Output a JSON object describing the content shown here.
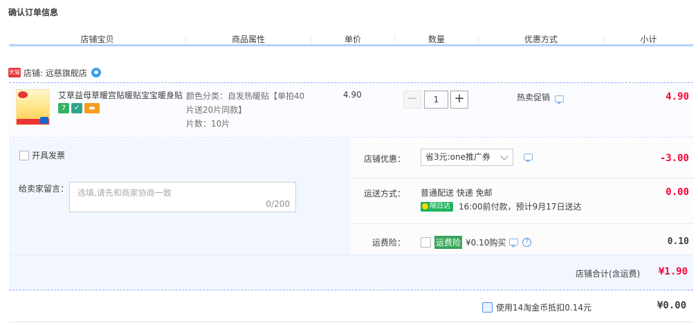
{
  "page": {
    "title": "确认订单信息"
  },
  "columns": [
    "店铺宝贝",
    "商品属性",
    "单价",
    "数量",
    "优惠方式",
    "小计"
  ],
  "shop": {
    "platform_badge": "天猫",
    "label": "店铺: 远慈旗舰店"
  },
  "item": {
    "title": "艾草益母草暖宫贴暖贴宝宝暖身贴",
    "badges": [
      "7",
      "✓",
      "▬"
    ],
    "attr_line1": "颜色分类：自发热暖贴【单拍40",
    "attr_line2": "片送20片同款】",
    "attr_line3": "片数：10片",
    "unit_price": "4.90",
    "quantity": "1",
    "qty_minus": "−",
    "qty_plus": "+",
    "promo": "热卖促销",
    "subtotal": "4.90"
  },
  "invoice": {
    "label": "开具发票"
  },
  "message": {
    "label": "给卖家留言：",
    "placeholder": "选填,请先和商家协商一致",
    "count": "0/200"
  },
  "coupon": {
    "label": "店铺优惠：",
    "selected": "省3元:one推广券",
    "amount": "-3.00"
  },
  "shipping": {
    "label": "运送方式：",
    "method": "普通配送 快递 免邮",
    "badge": "隔日达",
    "eta": "16:00前付款，预计9月17日送达",
    "amount": "0.00"
  },
  "insurance": {
    "label": "运费险：",
    "badge": "运费险",
    "price": "¥0.10购买",
    "help": "?",
    "amount": "0.10"
  },
  "shop_total": {
    "label": "店铺合计(含运费)",
    "value": "¥1.90"
  },
  "coins": {
    "label": "使用14淘金币抵扣0.14元",
    "value": "¥0.00"
  },
  "colors": {
    "accent_blue": "#b2d1ff",
    "price_red": "#ff0036",
    "panel_bg": "#f2f7ff"
  }
}
